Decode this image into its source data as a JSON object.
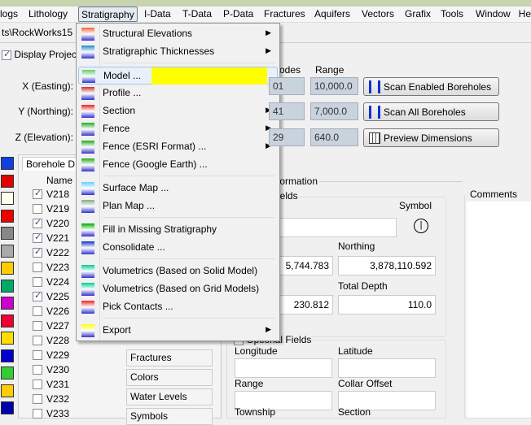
{
  "menubar": [
    "logs",
    "Lithology",
    "Stratigraphy",
    "I-Data",
    "T-Data",
    "P-Data",
    "Fractures",
    "Aquifers",
    "Vectors",
    "Grafix",
    "Tools",
    "Window",
    "He"
  ],
  "path": "ts\\RockWorks15",
  "display_project": "Display Projec",
  "dims": {
    "header_nodes": "odes",
    "header_range": "Range",
    "rows": [
      {
        "label": "X (Easting):",
        "nodes": "01",
        "range": "10,000.0"
      },
      {
        "label": "Y (Northing):",
        "nodes": "41",
        "range": "7,000.0"
      },
      {
        "label": "Z (Elevation):",
        "nodes": "29",
        "range": "640.0"
      }
    ],
    "buttons": [
      "Scan Enabled Boreholes",
      "Scan All Boreholes",
      "Preview Dimensions"
    ]
  },
  "menu": {
    "items": [
      {
        "label": "Structural Elevations",
        "sub": true,
        "icon": "structural-elevations-icon"
      },
      {
        "label": "Stratigraphic Thicknesses",
        "sub": true,
        "icon": "thickness-icon"
      },
      {
        "label": "Model ...",
        "sub": false,
        "icon": "model-icon"
      },
      {
        "label": "Profile ...",
        "sub": false,
        "icon": "profile-icon"
      },
      {
        "label": "Section",
        "sub": true,
        "icon": "section-icon"
      },
      {
        "label": "Fence",
        "sub": true,
        "icon": "fence-icon"
      },
      {
        "label": "Fence (ESRI Format) ...",
        "sub": true,
        "icon": "fence-esri-icon"
      },
      {
        "label": "Fence (Google Earth) ...",
        "sub": false,
        "icon": "fence-google-earth-icon"
      },
      {
        "label": "Surface Map ...",
        "sub": false,
        "icon": "surface-map-icon"
      },
      {
        "label": "Plan Map ...",
        "sub": false,
        "icon": "plan-map-icon"
      },
      {
        "label": "Fill in Missing Stratigraphy",
        "sub": false,
        "icon": "fill-stratigraphy-icon"
      },
      {
        "label": "Consolidate ...",
        "sub": false,
        "icon": "consolidate-icon"
      },
      {
        "label": "Volumetrics (Based on Solid Model)",
        "sub": false,
        "icon": "volumetrics-icon"
      },
      {
        "label": "Volumetrics (Based on Grid Models)",
        "sub": false,
        "icon": "volumetrics-grid-icon"
      },
      {
        "label": "Pick Contacts ...",
        "sub": false,
        "icon": "pick-contacts-icon"
      },
      {
        "label": "Export",
        "sub": true,
        "icon": "export-icon"
      }
    ],
    "highlight_color": "#ffff00"
  },
  "boreholes": {
    "tab": "Borehole D",
    "header": "Name",
    "items": [
      {
        "n": "V218",
        "c": true
      },
      {
        "n": "V219",
        "c": false
      },
      {
        "n": "V220",
        "c": true
      },
      {
        "n": "V221",
        "c": true
      },
      {
        "n": "V222",
        "c": true
      },
      {
        "n": "V223",
        "c": false
      },
      {
        "n": "V224",
        "c": false
      },
      {
        "n": "V225",
        "c": true
      },
      {
        "n": "V226",
        "c": false
      },
      {
        "n": "V227",
        "c": false
      },
      {
        "n": "V228",
        "c": false
      },
      {
        "n": "V229",
        "c": false
      },
      {
        "n": "V230",
        "c": false
      },
      {
        "n": "V231",
        "c": false
      },
      {
        "n": "V232",
        "c": false
      },
      {
        "n": "V233",
        "c": false
      }
    ]
  },
  "info": {
    "group": "formation",
    "fields_group": "ields",
    "symbol": "Symbol",
    "northing_label": "Northing",
    "easting_value": "5,744.783",
    "northing_value": "3,878,110.592",
    "total_depth_label": "Total Depth",
    "elevation_value": "230.812",
    "total_depth_value": "110.0",
    "optional": "Optional Fields",
    "longitude": "Longitude",
    "latitude": "Latitude",
    "range": "Range",
    "collar_offset": "Collar Offset",
    "township": "Township",
    "section": "Section",
    "comments": "Comments"
  },
  "tabs": [
    "Fractures",
    "Colors",
    "Water Levels",
    "Symbols"
  ]
}
